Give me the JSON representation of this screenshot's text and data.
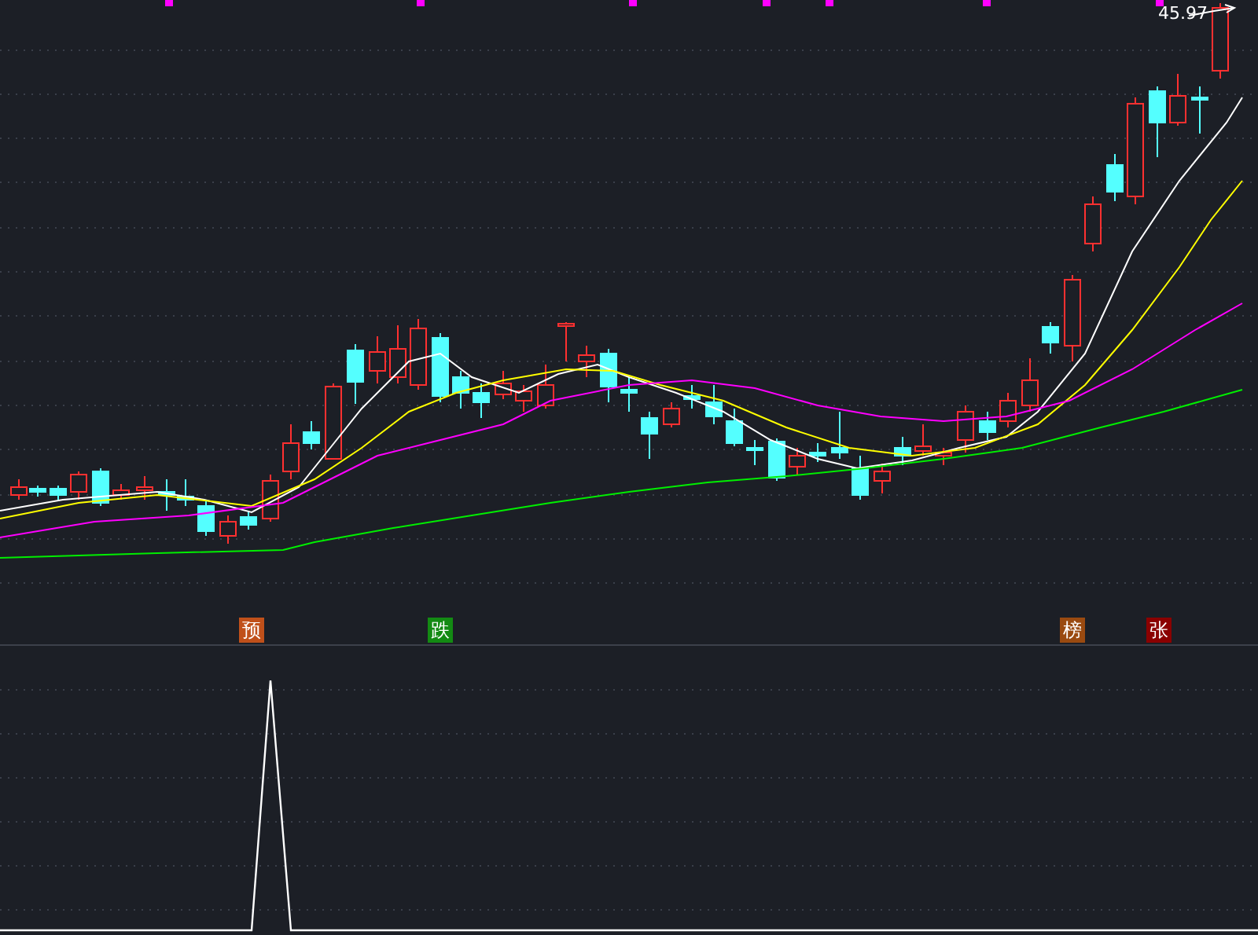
{
  "price_label": {
    "text": "45.97"
  },
  "signals": [
    {
      "label": "预",
      "color": "#c0501a"
    },
    {
      "label": "跌",
      "color": "#138a13"
    },
    {
      "label": "榜",
      "color": "#9a4a10"
    },
    {
      "label": "张",
      "color": "#8b0000"
    }
  ]
}
